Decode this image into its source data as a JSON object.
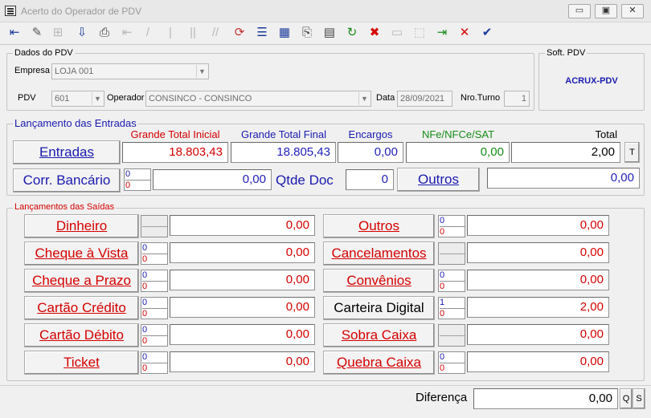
{
  "window": {
    "title": "Acerto do Operador de PDV"
  },
  "dados_pdv": {
    "group_label": "Dados do PDV",
    "empresa_label": "Empresa",
    "empresa_value": "LOJA 001",
    "pdv_label": "PDV",
    "pdv_value": "601",
    "operador_label": "Operador",
    "operador_value": "CONSINCO - CONSINCO",
    "data_label": "Data",
    "data_value": "28/09/2021",
    "turno_label": "Nro.Turno",
    "turno_value": "1"
  },
  "soft_pdv": {
    "group_label": "Soft. PDV",
    "value": "ACRUX-PDV"
  },
  "entradas": {
    "group_label": "Lançamento das Entradas",
    "headers": {
      "grande_total_inicial": "Grande Total Inicial",
      "grande_total_final": "Grande Total Final",
      "encargos": "Encargos",
      "nfe": "NFe/NFCe/SAT",
      "total": "Total"
    },
    "entradas_button": "Entradas",
    "grande_total_inicial": "18.803,43",
    "grande_total_final": "18.805,43",
    "encargos": "0,00",
    "nfe": "0,00",
    "total": "2,00",
    "t_button": "T",
    "corr_bancario_button": "Corr. Bancário",
    "corr_count_top": "0",
    "corr_count_bottom": "0",
    "corr_value": "0,00",
    "qtde_doc_label": "Qtde Doc",
    "qtde_doc_value": "0",
    "outros_button": "Outros",
    "outros_value": "0,00"
  },
  "saidas": {
    "group_label": "Lançamentos das Saídas",
    "left": [
      {
        "label": "Dinheiro",
        "top": "",
        "bottom": "",
        "value": "0,00"
      },
      {
        "label": "Cheque à Vista",
        "top": "0",
        "bottom": "0",
        "value": "0,00"
      },
      {
        "label": "Cheque a Prazo",
        "top": "0",
        "bottom": "0",
        "value": "0,00"
      },
      {
        "label": "Cartão Crédito",
        "top": "0",
        "bottom": "0",
        "value": "0,00"
      },
      {
        "label": "Cartão Débito",
        "top": "0",
        "bottom": "0",
        "value": "0,00"
      },
      {
        "label": "Ticket",
        "top": "0",
        "bottom": "0",
        "value": "0,00"
      }
    ],
    "right": [
      {
        "label": "Outros",
        "top": "0",
        "bottom": "0",
        "value": "0,00"
      },
      {
        "label": "Cancelamentos",
        "top": "",
        "bottom": "",
        "value": "0,00"
      },
      {
        "label": "Convênios",
        "top": "0",
        "bottom": "0",
        "value": "0,00"
      },
      {
        "label": "Carteira Digital",
        "top": "1",
        "bottom": "0",
        "value": "2,00"
      },
      {
        "label": "Sobra Caixa",
        "top": "",
        "bottom": "",
        "value": "0,00"
      },
      {
        "label": "Quebra Caixa",
        "top": "0",
        "bottom": "0",
        "value": "0,00"
      }
    ]
  },
  "footer": {
    "diferenca_label": "Diferença",
    "diferenca_value": "0,00",
    "q_button": "Q",
    "s_button": "S"
  },
  "toolbar": {
    "icons": [
      "exit-icon",
      "edit-icon",
      "tree-icon",
      "download-icon",
      "print-icon",
      "first-icon",
      "prev-icon",
      "pause-icon",
      "next-icon",
      "last-icon",
      "refresh-icon",
      "list-icon",
      "grid-icon",
      "preview-icon",
      "report-icon",
      "reload-icon",
      "delete-icon",
      "blank1-icon",
      "blank2-icon",
      "confirm-icon",
      "cancel-icon",
      "check-icon"
    ]
  },
  "colors": {
    "red": "#d40000",
    "blue": "#1a1ab0",
    "green": "#168c16"
  }
}
